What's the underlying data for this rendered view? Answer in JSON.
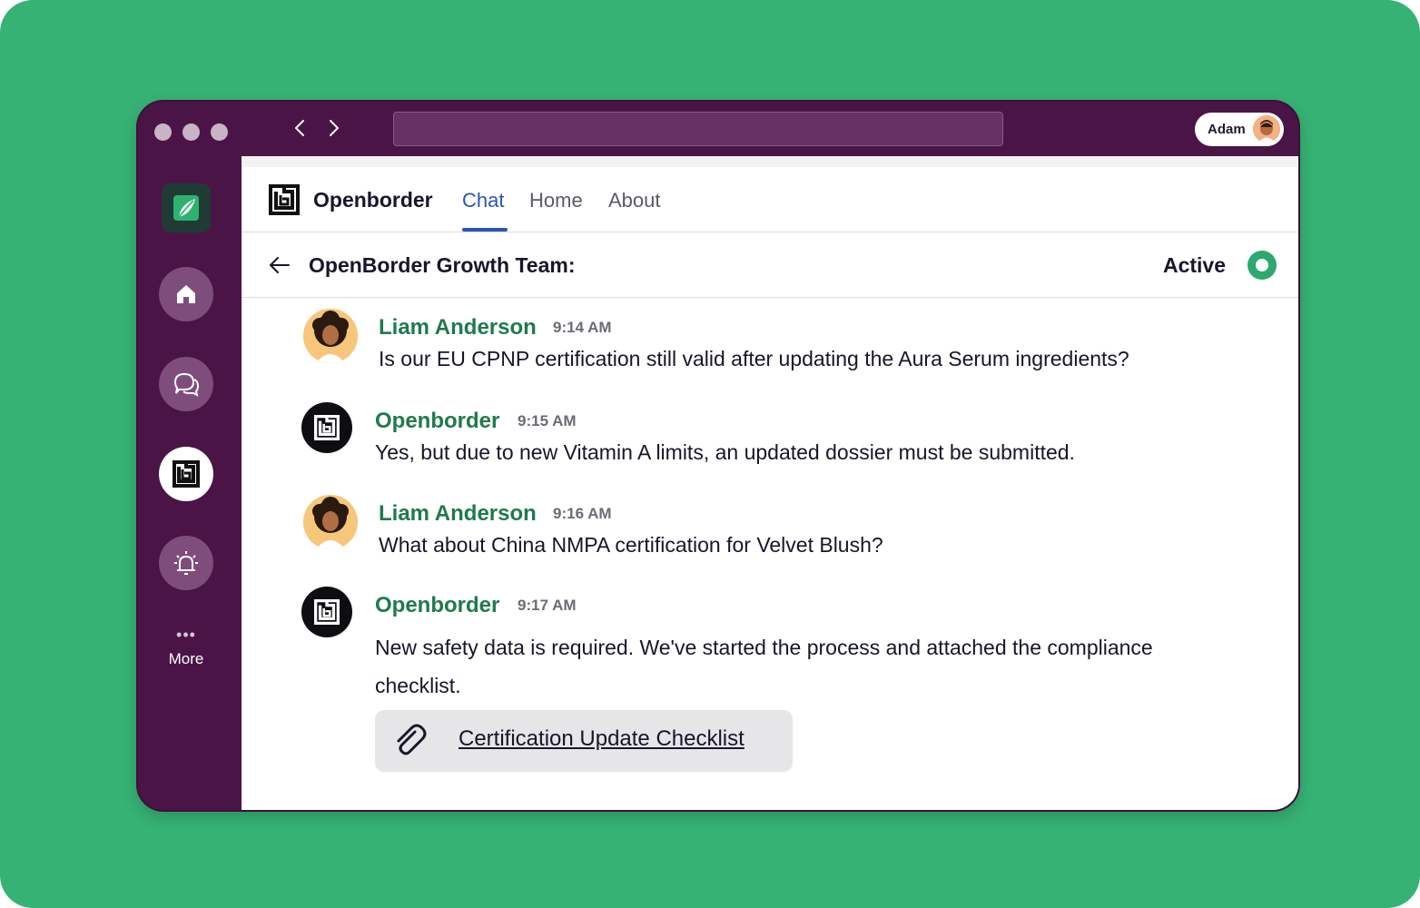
{
  "window": {
    "user": {
      "name": "Adam",
      "avatar_icon": "user-avatar"
    }
  },
  "sidebar": {
    "items": [
      {
        "name": "home",
        "icon": "home-icon"
      },
      {
        "name": "chat",
        "icon": "chat-bubbles-icon"
      },
      {
        "name": "openborder",
        "icon": "openborder-logo-icon"
      },
      {
        "name": "alerts",
        "icon": "alarm-icon"
      }
    ],
    "more_label": "More",
    "more_dots": "•••"
  },
  "app": {
    "brand": "Openborder",
    "tabs": [
      {
        "label": "Chat",
        "active": true
      },
      {
        "label": "Home",
        "active": false
      },
      {
        "label": "About",
        "active": false
      }
    ]
  },
  "channel": {
    "title": "OpenBorder Growth Team:",
    "status": "Active",
    "status_color": "#2da86e"
  },
  "messages": [
    {
      "sender": "Liam Anderson",
      "time": "9:14 AM",
      "text": "Is our EU CPNP certification still valid after updating the Aura Serum ingredients?"
    },
    {
      "sender": "Openborder",
      "time": "9:15 AM",
      "text": "Yes, but due to new Vitamin A limits, an updated dossier must be submitted."
    },
    {
      "sender": "Liam Anderson",
      "time": "9:16 AM",
      "text": "What about China NMPA certification for Velvet Blush?"
    },
    {
      "sender": "Openborder",
      "time": "9:17 AM",
      "text_line1": "New safety data is required. We've started the process and attached the compliance",
      "text_line2": "checklist."
    }
  ],
  "attachment": {
    "label": "Certification Update Checklist",
    "icon": "paperclip-icon"
  },
  "colors": {
    "background": "#36b274",
    "window_chrome": "#4a1546",
    "sender_name": "#1f7a4d",
    "accent_tab": "#2b56ad"
  }
}
